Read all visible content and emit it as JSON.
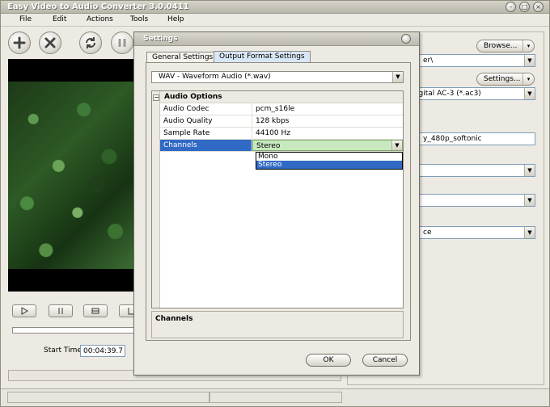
{
  "app": {
    "title": "Easy Video to Audio Converter 3.0.0411"
  },
  "menu": [
    "File",
    "Edit",
    "Actions",
    "Tools",
    "Help"
  ],
  "toolbar": {
    "buttons": [
      "add-icon",
      "remove-icon",
      "convert-icon",
      "pause-icon"
    ]
  },
  "player": {
    "start_time_label": "Start Time:",
    "start_time_value": "00:04:39.7"
  },
  "right_panel": {
    "browse_label": "Browse...",
    "output_folder_partial": "er\\",
    "settings_label": "Settings...",
    "format_partial": "igital AC-3 (*.ac3)",
    "filename_partial": "y_480p_softonic",
    "combo3_partial": "ce"
  },
  "dialog": {
    "title": "Settings",
    "tabs": [
      "General Settings",
      "Output Format Settings"
    ],
    "active_tab": "Output Format Settings",
    "format": "WAV - Waveform Audio (*.wav)",
    "category": "Audio Options",
    "properties": [
      {
        "key": "Audio Codec",
        "value": "pcm_s16le"
      },
      {
        "key": "Audio Quality",
        "value": "128 kbps"
      },
      {
        "key": "Sample Rate",
        "value": "44100 Hz"
      },
      {
        "key": "Channels",
        "value": "Stereo"
      }
    ],
    "dropdown_options": [
      "Mono",
      "Stereo"
    ],
    "dropdown_selected": "Stereo",
    "description_title": "Channels",
    "ok_label": "OK",
    "cancel_label": "Cancel"
  },
  "colors": {
    "selection": "#316ac5",
    "value_edit": "#c8e8bf",
    "active_tab": "#d8e6f6"
  }
}
